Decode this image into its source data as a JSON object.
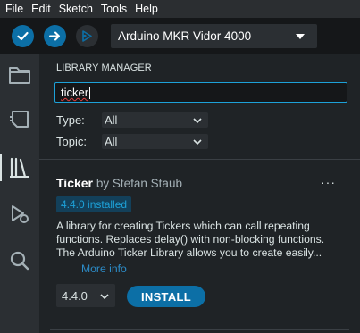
{
  "menu": {
    "items": [
      "File",
      "Edit",
      "Sketch",
      "Tools",
      "Help"
    ]
  },
  "toolbar": {
    "verify_icon": "check-icon",
    "upload_icon": "arrow-right-icon",
    "debug_icon": "debug-icon",
    "board_label": "Arduino MKR Vidor 4000"
  },
  "activity": {
    "items": [
      "folder-icon",
      "board-icon",
      "library-icon",
      "debug-icon",
      "search-icon"
    ],
    "active": "library-icon"
  },
  "library_manager": {
    "title": "LIBRARY MANAGER",
    "search_value": "ticker",
    "type_label": "Type:",
    "type_value": "All",
    "topic_label": "Topic:",
    "topic_value": "All"
  },
  "library": {
    "name": "Ticker",
    "author": "by Stefan Staub",
    "badge": "4.4.0 installed",
    "description_lines": [
      "A library for creating Tickers which can call repeating",
      "functions. Replaces delay() with non-blocking functions.",
      "The Arduino Ticker Library allows you to create easily..."
    ],
    "more_info": "More info",
    "version": "4.4.0",
    "install_label": "INSTALL",
    "more_menu": "···"
  },
  "colors": {
    "accent": "#0c6fa6",
    "focus": "#1da1d8",
    "background": "#1f2326"
  }
}
